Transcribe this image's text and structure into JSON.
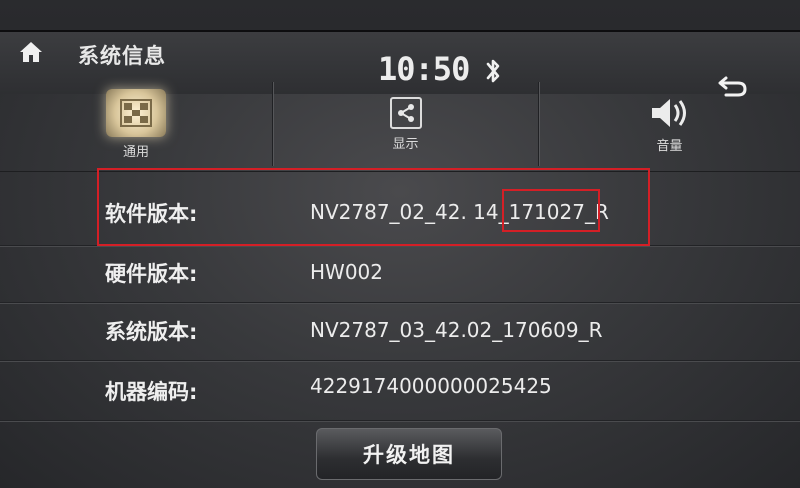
{
  "header": {
    "title": "系统信息",
    "clock": "10:50"
  },
  "tabs": [
    {
      "label": "通用",
      "icon": "grid-icon",
      "active": true
    },
    {
      "label": "显示",
      "icon": "share-icon",
      "active": false
    },
    {
      "label": "音量",
      "icon": "speaker-icon",
      "active": false
    }
  ],
  "info": [
    {
      "label": "软件版本:",
      "value": "NV2787_02_42. 14_171027_R"
    },
    {
      "label": "硬件版本:",
      "value": "HW002"
    },
    {
      "label": "系统版本:",
      "value": "NV2787_03_42.02_170609_R"
    },
    {
      "label": "机器编码:",
      "value": "4229174000000025425"
    }
  ],
  "footer": {
    "upgrade_label": "升级地图"
  },
  "colors": {
    "highlight_box": "#d41f26",
    "active_tab_glow": "#fff3d6"
  }
}
